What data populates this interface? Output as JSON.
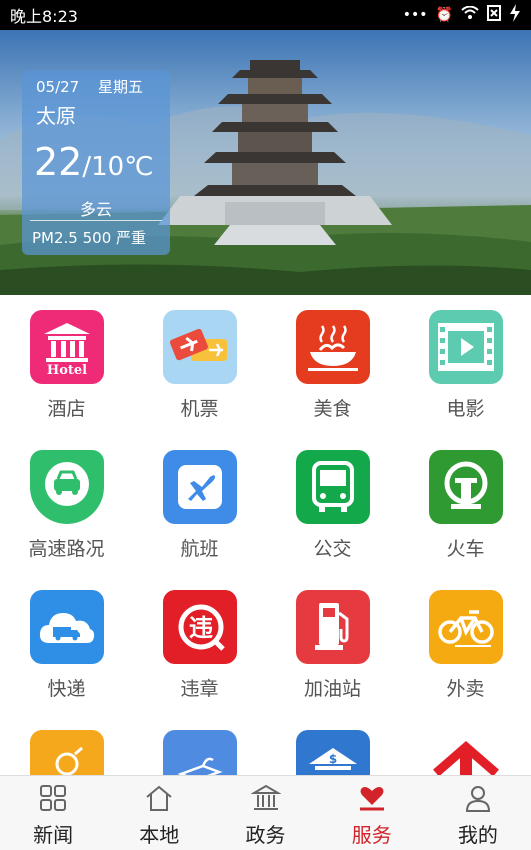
{
  "status_bar": {
    "time": "晚上8:23",
    "icons": [
      "more-dots-icon",
      "alarm-off-icon",
      "wifi-icon",
      "sim-icon",
      "charging-icon"
    ]
  },
  "weather": {
    "date": "05/27",
    "weekday": "星期五",
    "city": "太原",
    "temp_high": "22",
    "temp_low": "/10℃",
    "condition": "多云",
    "aqi": "PM2.5 500 严重"
  },
  "services": [
    {
      "label": "酒店",
      "icon": "hotel-icon",
      "color": "#ef2b78"
    },
    {
      "label": "机票",
      "icon": "flight-ticket-icon",
      "color": "#a9d6f3"
    },
    {
      "label": "美食",
      "icon": "food-icon",
      "color": "#e53b1e"
    },
    {
      "label": "电影",
      "icon": "movie-icon",
      "color": "#5ccbb0"
    },
    {
      "label": "高速路况",
      "icon": "highway-icon",
      "color": "#2fbf6c"
    },
    {
      "label": "航班",
      "icon": "airplane-icon",
      "color": "#3f8be8"
    },
    {
      "label": "公交",
      "icon": "bus-icon",
      "color": "#13a84a"
    },
    {
      "label": "火车",
      "icon": "train-icon",
      "color": "#2f9a31"
    },
    {
      "label": "快递",
      "icon": "delivery-icon",
      "color": "#2f8fe6"
    },
    {
      "label": "违章",
      "icon": "violation-icon",
      "color": "#e21f27"
    },
    {
      "label": "加油站",
      "icon": "gas-station-icon",
      "color": "#e63a41"
    },
    {
      "label": "外卖",
      "icon": "takeout-icon",
      "color": "#f6aa12"
    },
    {
      "label": "",
      "icon": "bottom-service-icon-1",
      "color": "#f5a81c"
    },
    {
      "label": "",
      "icon": "bottom-service-icon-2",
      "color": "#4f8be0"
    },
    {
      "label": "",
      "icon": "bottom-service-icon-3",
      "color": "#2f77cf"
    },
    {
      "label": "",
      "icon": "bottom-service-icon-4",
      "color": "#ffffff"
    }
  ],
  "tabs": [
    {
      "label": "新闻",
      "icon": "grid-icon",
      "active": false
    },
    {
      "label": "本地",
      "icon": "home-icon",
      "active": false
    },
    {
      "label": "政务",
      "icon": "government-icon",
      "active": false
    },
    {
      "label": "服务",
      "icon": "heart-hand-icon",
      "active": true
    },
    {
      "label": "我的",
      "icon": "user-icon",
      "active": false
    }
  ],
  "colors": {
    "active_tab": "#d2232a",
    "inactive_tab": "#222222"
  }
}
